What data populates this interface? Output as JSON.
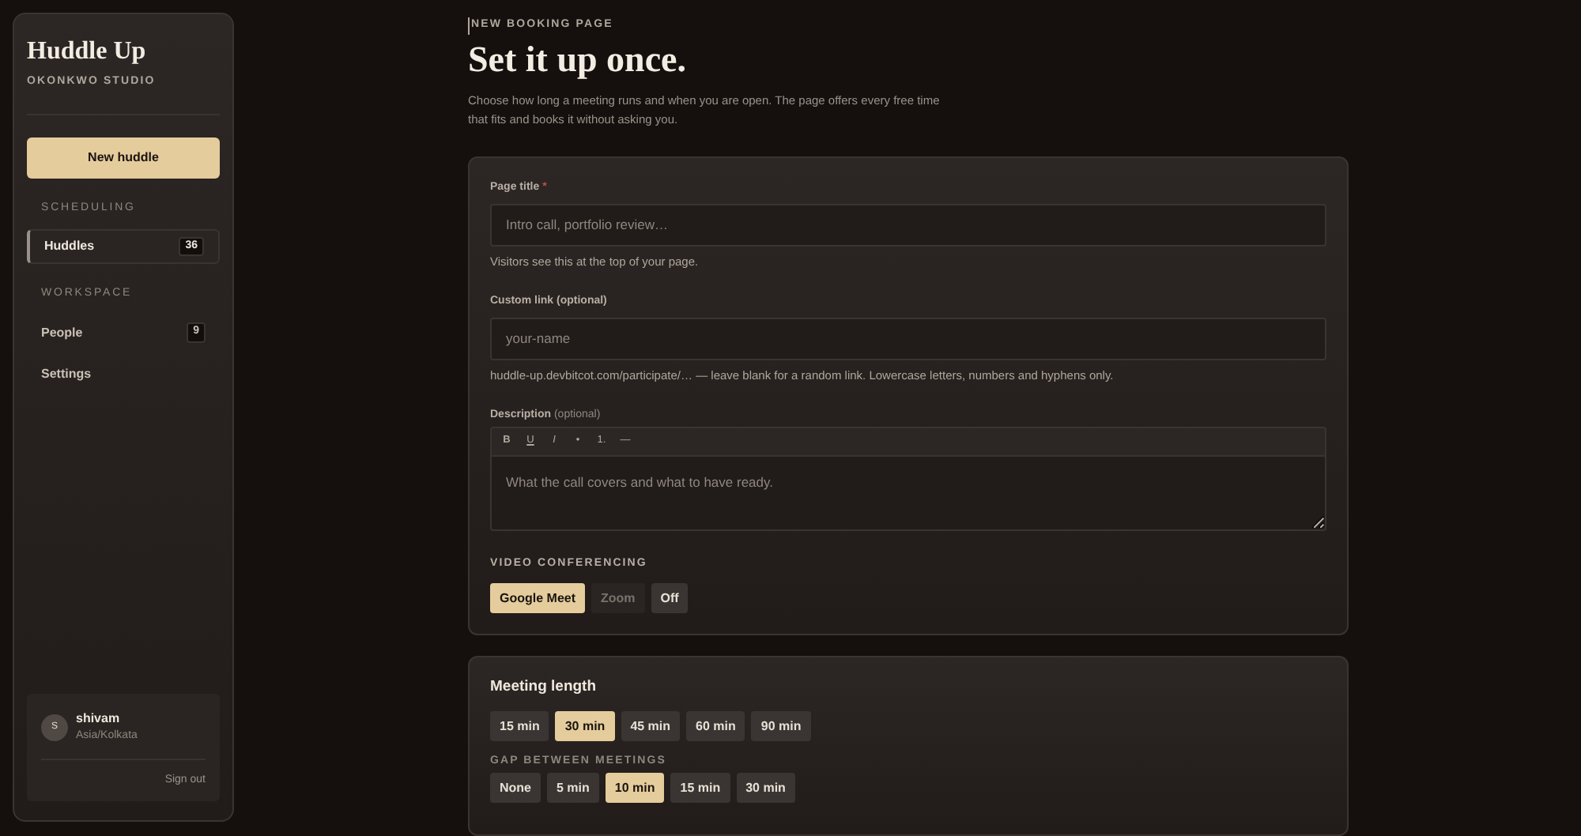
{
  "sidebar": {
    "brand": "Huddle Up",
    "studio": "OKONKWO STUDIO",
    "new_button": "New huddle",
    "sections": [
      {
        "heading": "SCHEDULING",
        "items": [
          {
            "label": "Huddles",
            "count": "36",
            "selected": true
          }
        ]
      },
      {
        "heading": "WORKSPACE",
        "items": [
          {
            "label": "People",
            "count": "9",
            "selected": false
          },
          {
            "label": "Settings",
            "selected": false
          }
        ]
      }
    ],
    "user": {
      "initial": "S",
      "name": "shivam",
      "timezone": "Asia/Kolkata",
      "sign_out": "Sign out"
    }
  },
  "header": {
    "eyebrow": "NEW BOOKING PAGE",
    "title": "Set it up once.",
    "intro": "Choose how long a meeting runs and when you are open. The page offers every free time that fits and books it without asking you."
  },
  "form": {
    "page_title": {
      "label": "Page title",
      "required": "*",
      "placeholder": "Intro call, portfolio review…",
      "hint": "Visitors see this at the top of your page."
    },
    "custom_link": {
      "label": "Custom link (optional)",
      "placeholder": "your-name",
      "hint": "huddle-up.devbitcot.com/participate/… — leave blank for a random link. Lowercase letters, numbers and hyphens only."
    },
    "description": {
      "label": "Description",
      "note": "(optional)",
      "toolbar": [
        "B",
        "U",
        "I",
        "•",
        "1.",
        "—"
      ],
      "placeholder": "What the call covers and what to have ready."
    },
    "video": {
      "heading": "VIDEO CONFERENCING",
      "options": [
        {
          "label": "Google Meet",
          "selected": true,
          "disabled": false
        },
        {
          "label": "Zoom",
          "selected": false,
          "disabled": true
        },
        {
          "label": "Off",
          "selected": false,
          "disabled": false
        }
      ]
    }
  },
  "length": {
    "title": "Meeting length",
    "options": [
      {
        "label": "15 min",
        "selected": false
      },
      {
        "label": "30 min",
        "selected": true
      },
      {
        "label": "45 min",
        "selected": false
      },
      {
        "label": "60 min",
        "selected": false
      },
      {
        "label": "90 min",
        "selected": false
      }
    ],
    "gap_heading": "GAP BETWEEN MEETINGS",
    "gaps": [
      {
        "label": "None",
        "selected": false
      },
      {
        "label": "5 min",
        "selected": false
      },
      {
        "label": "10 min",
        "selected": true
      },
      {
        "label": "15 min",
        "selected": false
      },
      {
        "label": "30 min",
        "selected": false
      }
    ]
  }
}
